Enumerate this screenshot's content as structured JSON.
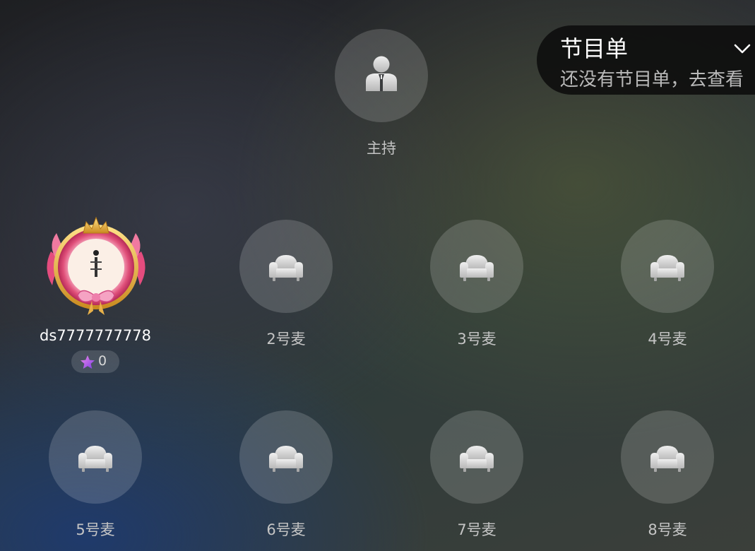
{
  "program_panel": {
    "title": "节目单",
    "subtitle": "还没有节目单，去查看"
  },
  "host_seat": {
    "label": "主持",
    "icon": "host-person-icon"
  },
  "occupied_seat": {
    "username": "ds7777777778",
    "score": "0",
    "icon": "star-icon"
  },
  "seats": [
    {
      "label": "2号麦",
      "icon": "sofa-icon"
    },
    {
      "label": "3号麦",
      "icon": "sofa-icon"
    },
    {
      "label": "4号麦",
      "icon": "sofa-icon"
    },
    {
      "label": "5号麦",
      "icon": "sofa-icon"
    },
    {
      "label": "6号麦",
      "icon": "sofa-icon"
    },
    {
      "label": "7号麦",
      "icon": "sofa-icon"
    },
    {
      "label": "8号麦",
      "icon": "sofa-icon"
    }
  ],
  "colors": {
    "panel_bg": "#0c0c0c",
    "seat_circle": "#ffffff29",
    "label_text": "#c4c4c4",
    "avatar_frame_pink": "#e0507a",
    "avatar_frame_gold": "#e6b54a",
    "star_gradient": "#d94fd1"
  }
}
